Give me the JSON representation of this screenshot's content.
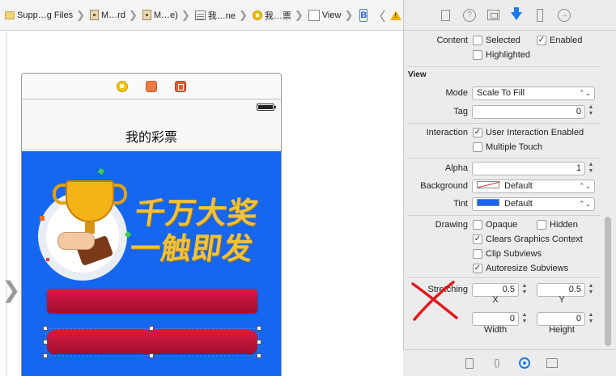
{
  "jumpbar": {
    "crumbs": [
      "Supp…g Files",
      "M…rd",
      "M…e)",
      "我…ne",
      "我…票",
      "View"
    ],
    "b_label": "B",
    "warning_glyph": "!"
  },
  "canvas": {
    "nav_title": "我的彩票",
    "slogan_line1": "千万大奖",
    "slogan_line2": "一触即发",
    "background_color": "#1766ef",
    "button_color": "#c01238"
  },
  "inspector": {
    "content": {
      "label": "Content",
      "selected_label": "Selected",
      "selected_checked": false,
      "enabled_label": "Enabled",
      "enabled_checked": true,
      "highlighted_label": "Highlighted",
      "highlighted_checked": false
    },
    "view_section_title": "View",
    "mode": {
      "label": "Mode",
      "value": "Scale To Fill"
    },
    "tag": {
      "label": "Tag",
      "value": "0"
    },
    "interaction": {
      "label": "Interaction",
      "user_interaction_label": "User Interaction Enabled",
      "user_interaction_checked": true,
      "multiple_touch_label": "Multiple Touch",
      "multiple_touch_checked": false
    },
    "alpha": {
      "label": "Alpha",
      "value": "1"
    },
    "background": {
      "label": "Background",
      "value": "Default"
    },
    "tint": {
      "label": "Tint",
      "value": "Default",
      "color": "#1766ef"
    },
    "drawing": {
      "label": "Drawing",
      "opaque_label": "Opaque",
      "opaque_checked": false,
      "hidden_label": "Hidden",
      "hidden_checked": false,
      "clears_label": "Clears Graphics Context",
      "clears_checked": true,
      "clip_label": "Clip Subviews",
      "clip_checked": false,
      "autoresize_label": "Autoresize Subviews",
      "autoresize_checked": true
    },
    "stretching": {
      "label": "Stretching",
      "x_value": "0.5",
      "x_label": "X",
      "y_value": "0.5",
      "y_label": "Y",
      "width_value": "0",
      "width_label": "Width",
      "height_value": "0",
      "height_label": "Height"
    },
    "accent_color": "#1a7cf5"
  },
  "icons": {
    "check": "✓",
    "chevron_updown": "⌃⌄",
    "stepper_up": "▲",
    "stepper_down": "▼",
    "crumb_sep": "❯",
    "nav_back": "〈",
    "canvas_arrow": "❯",
    "help": "?",
    "connections": "→",
    "code_braces": "{}"
  }
}
